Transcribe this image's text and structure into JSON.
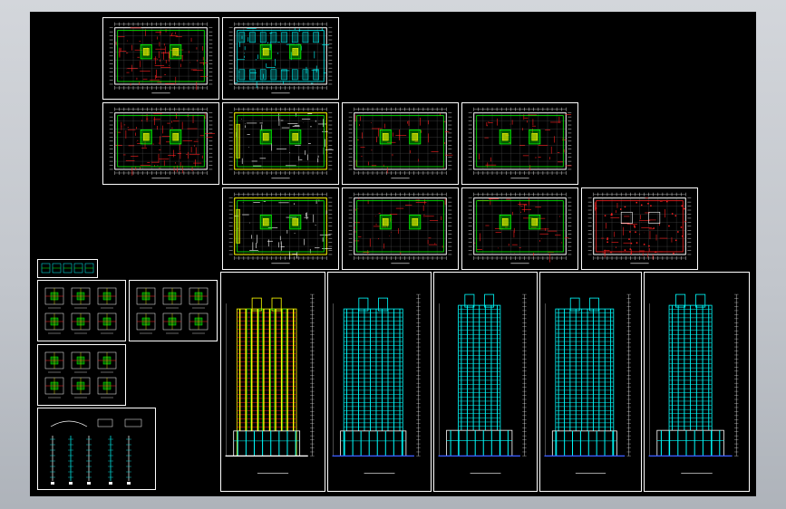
{
  "theme": {
    "background": "#000000",
    "frame": "#ffffff",
    "cyan": "#00ffff",
    "green": "#00ff00",
    "red": "#ff2020",
    "yellow": "#ffff00",
    "blue": "#3a5cff",
    "white": "#ffffff"
  },
  "sheets": [
    {
      "id": "plan-basement-1",
      "type": "plan",
      "variant": "dense",
      "label": ""
    },
    {
      "id": "plan-basement-2",
      "type": "plan",
      "variant": "cyan",
      "label": ""
    },
    {
      "id": "plan-ground",
      "type": "plan",
      "variant": "dense",
      "label": ""
    },
    {
      "id": "plan-2f",
      "type": "plan",
      "variant": "yellow",
      "label": ""
    },
    {
      "id": "plan-3f",
      "type": "plan",
      "variant": "redgreen",
      "label": ""
    },
    {
      "id": "plan-4f",
      "type": "plan",
      "variant": "redgreen",
      "label": ""
    },
    {
      "id": "plan-5f",
      "type": "plan",
      "variant": "yellow",
      "label": ""
    },
    {
      "id": "plan-6f",
      "type": "plan",
      "variant": "redgreen",
      "label": ""
    },
    {
      "id": "plan-7f",
      "type": "plan",
      "variant": "redgreen",
      "label": ""
    },
    {
      "id": "plan-roof",
      "type": "plan",
      "variant": "red",
      "label": ""
    },
    {
      "id": "detail-small",
      "type": "detail",
      "variant": "small",
      "label": ""
    },
    {
      "id": "detail-units-a",
      "type": "detail",
      "variant": "units",
      "label": ""
    },
    {
      "id": "detail-units-b",
      "type": "detail",
      "variant": "units",
      "label": ""
    },
    {
      "id": "detail-units-c",
      "type": "detail",
      "variant": "units",
      "label": ""
    },
    {
      "id": "detail-sections",
      "type": "detail",
      "variant": "sections",
      "label": ""
    },
    {
      "id": "elev-south",
      "type": "elevation",
      "variant": "yellow",
      "label": ""
    },
    {
      "id": "elev-north",
      "type": "elevation",
      "variant": "cyan",
      "label": ""
    },
    {
      "id": "elev-east",
      "type": "elevation",
      "variant": "slim",
      "label": ""
    },
    {
      "id": "elev-west",
      "type": "elevation",
      "variant": "cyan",
      "label": ""
    },
    {
      "id": "elev-side",
      "type": "elevation",
      "variant": "slim",
      "label": ""
    }
  ]
}
